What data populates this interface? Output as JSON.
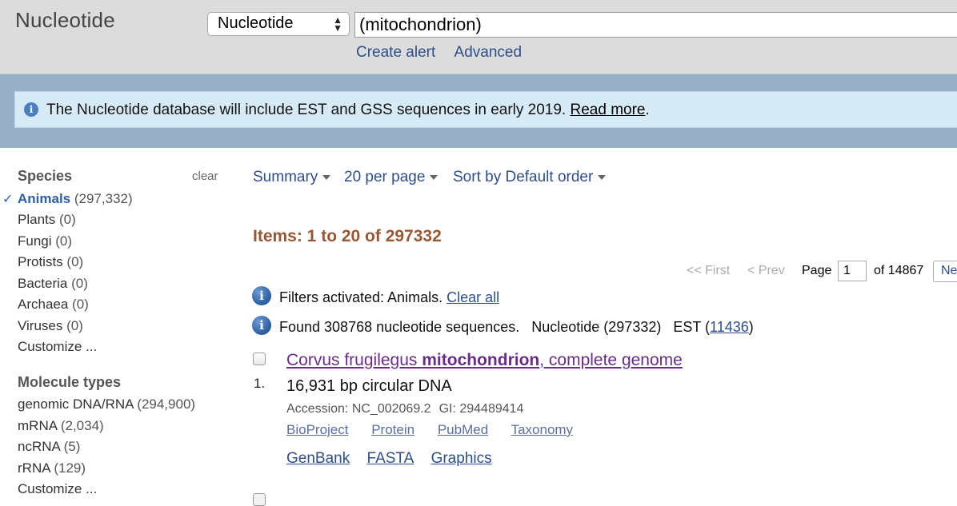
{
  "header": {
    "db_title": "Nucleotide",
    "db_select_value": "Nucleotide",
    "search_value": "(mitochondrion)",
    "links": {
      "create_alert": "Create alert",
      "advanced": "Advanced"
    }
  },
  "banner": {
    "text": "The Nucleotide database will include EST and GSS sequences in early 2019. ",
    "link": "Read more",
    "period": "."
  },
  "sidebar": {
    "species": {
      "heading": "Species",
      "clear": "clear",
      "items": [
        {
          "label": "Animals",
          "count": " (297,332)"
        },
        {
          "label": "Plants",
          "count": " (0)"
        },
        {
          "label": "Fungi",
          "count": " (0)"
        },
        {
          "label": "Protists",
          "count": " (0)"
        },
        {
          "label": "Bacteria",
          "count": " (0)"
        },
        {
          "label": "Archaea",
          "count": " (0)"
        },
        {
          "label": "Viruses",
          "count": " (0)"
        }
      ],
      "customize": "Customize ..."
    },
    "molecule_types": {
      "heading": "Molecule types",
      "items": [
        {
          "label": "genomic DNA/RNA",
          "count": " (294,900)"
        },
        {
          "label": "mRNA",
          "count": " (2,034)"
        },
        {
          "label": "ncRNA",
          "count": " (5)"
        },
        {
          "label": "rRNA",
          "count": " (129)"
        }
      ],
      "customize": "Customize ..."
    },
    "checkmark": "✓"
  },
  "toolbar": {
    "summary": "Summary",
    "per_page": "20 per page",
    "sort": "Sort by Default order"
  },
  "results": {
    "items_count": "Items: 1 to 20 of 297332",
    "pager": {
      "first": "<< First",
      "prev": "< Prev",
      "page_label": "Page",
      "page_value": "1",
      "of_label": "of 14867",
      "next": "Ne"
    },
    "filters_msg": {
      "text": "Filters activated: Animals. ",
      "link": "Clear all"
    },
    "found_msg": {
      "text": "Found 308768 nucleotide sequences.   Nucleotide (297332)   EST (",
      "link": "11436",
      "close": ")"
    },
    "items": [
      {
        "rank": "1.",
        "title_prefix": "Corvus frugilegus ",
        "title_bold": "mitochondrion",
        "title_suffix": ", complete genome",
        "description": "16,931 bp circular DNA",
        "accession": "Accession: NC_002069.2",
        "gi": "GI: 294489414",
        "links": [
          "BioProject",
          "Protein",
          "PubMed",
          "Taxonomy"
        ],
        "formats": [
          "GenBank",
          "FASTA",
          "Graphics"
        ]
      }
    ]
  },
  "icons": {
    "info": "info-icon",
    "select_arrows": "up-down-arrows-icon",
    "caret": "caret-down-icon"
  },
  "colors": {
    "header_bg": "#dcdcdc",
    "banner_band": "#98b1c9",
    "banner_bg": "#d6ebf7",
    "link": "#2d4f8b",
    "visited": "#6a2c8d",
    "items_count": "#985735"
  }
}
